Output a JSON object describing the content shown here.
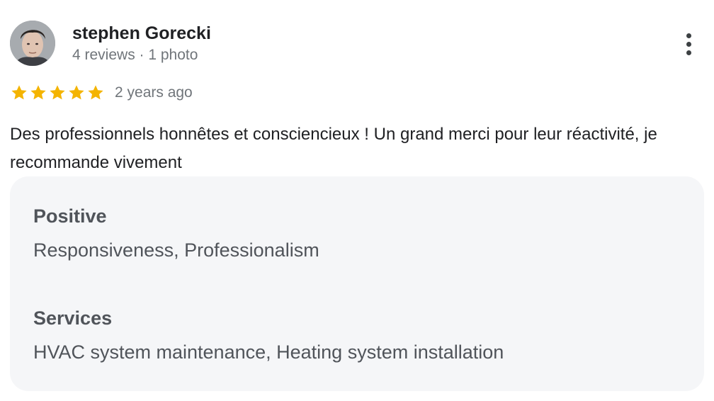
{
  "author": {
    "name": "stephen Gorecki",
    "meta": "4 reviews · 1 photo",
    "avatar_icon": "user-avatar-photo"
  },
  "menu": {
    "icon": "more-vertical-icon"
  },
  "rating": {
    "stars": 5,
    "max_stars": 5,
    "star_color": "#f4b400",
    "date": "2 years ago"
  },
  "review": {
    "text": "Des professionnels honnêtes et consciencieux ! Un grand merci pour leur réactivité, je recommande vivement"
  },
  "attributes": [
    {
      "title": "Positive",
      "value": "Responsiveness, Professionalism"
    },
    {
      "title": "Services",
      "value": "HVAC system maintenance, Heating system installation"
    }
  ]
}
